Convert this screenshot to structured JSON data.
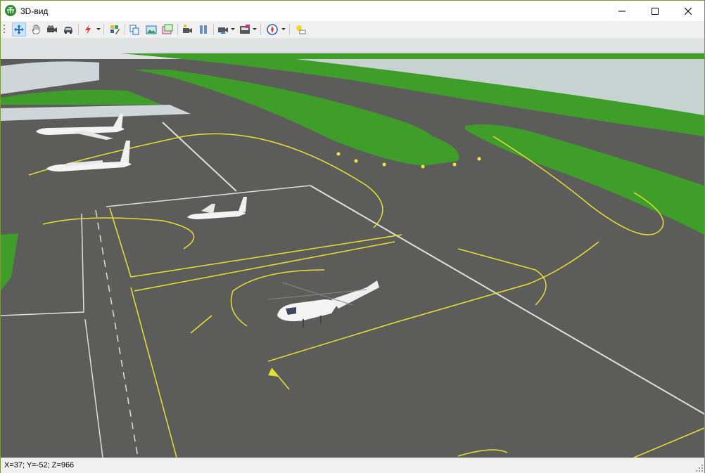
{
  "window": {
    "title": "3D-вид",
    "buttons": {
      "minimize": "minimize-icon",
      "maximize": "maximize-icon",
      "close": "close-icon"
    }
  },
  "toolbar": {
    "tools": [
      {
        "name": "move-tool",
        "icon": "move-arrows-icon",
        "active": true
      },
      {
        "name": "pan-tool",
        "icon": "hand-icon",
        "active": false
      },
      {
        "name": "camera-tool",
        "icon": "video-camera-icon",
        "active": false
      },
      {
        "name": "car-tool",
        "icon": "car-icon",
        "active": false
      },
      {
        "name": "effects-tool",
        "icon": "lightning-icon",
        "dropdown": true
      },
      {
        "name": "layers-tool",
        "icon": "palette-icon"
      },
      {
        "name": "copy-tool",
        "icon": "copy-icon"
      },
      {
        "name": "image-tool",
        "icon": "image-icon"
      },
      {
        "name": "gallery-tool",
        "icon": "gallery-icon"
      },
      {
        "name": "record-tool",
        "icon": "record-icon"
      },
      {
        "name": "pause-tool",
        "icon": "pause-icon"
      },
      {
        "name": "camera-view-tool",
        "icon": "camera-view-icon",
        "dropdown": true
      },
      {
        "name": "save-view-tool",
        "icon": "save-view-icon",
        "dropdown": true
      },
      {
        "name": "compass-tool",
        "icon": "compass-icon",
        "dropdown": true
      },
      {
        "name": "light-tool",
        "icon": "light-bulb-icon"
      }
    ]
  },
  "status": {
    "coordinates": "X=37; Y=-52; Z=966"
  },
  "colors": {
    "asphalt": "#5c5c5a",
    "grass": "#3f9e2a",
    "taxi_line": "#e8e030",
    "sea": "#cfd6d9",
    "sky": "#dfe3e3"
  }
}
